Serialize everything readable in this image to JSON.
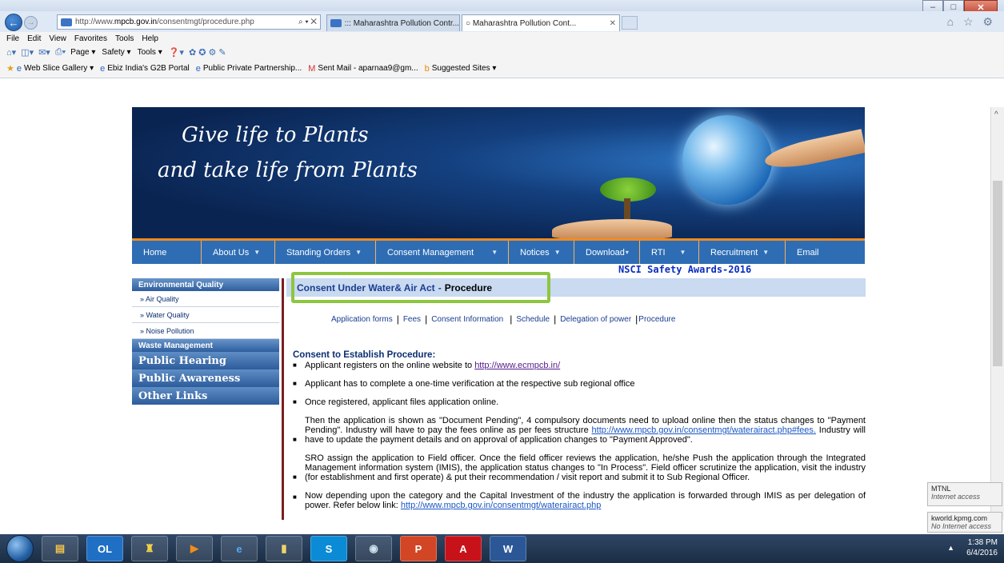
{
  "browser": {
    "url_prefix": "http://www.",
    "url_domain": "mpcb.gov.in",
    "url_path": "/consentmgt/procedure.php",
    "address_tools": "⌕ ▾ ✕",
    "tabs": [
      {
        "label": "::: Maharashtra Pollution Contr..."
      },
      {
        "label": "Maharashtra Pollution Cont...",
        "close": "✕"
      }
    ],
    "right_icons": "⌂ ☆ ⚙"
  },
  "menu": [
    "File",
    "Edit",
    "View",
    "Favorites",
    "Tools",
    "Help"
  ],
  "command_bar": [
    "Page ▾",
    "Safety ▾",
    "Tools ▾"
  ],
  "favorites": [
    {
      "icon": "★",
      "label": ""
    },
    {
      "icon": "e",
      "label": "Web Slice Gallery ▾"
    },
    {
      "icon": "e",
      "label": "Ebiz India's G2B Portal"
    },
    {
      "icon": "e",
      "label": "Public Private Partnership..."
    },
    {
      "icon": "M",
      "label": "Sent Mail - aparnaa9@gm..."
    },
    {
      "icon": "b",
      "label": "Suggested Sites ▾"
    }
  ],
  "banner": {
    "line1": "Give life to Plants",
    "line2": "and take life from Plants"
  },
  "nav": {
    "items": [
      {
        "label": "Home",
        "caret": ""
      },
      {
        "label": "About Us",
        "caret": "▼"
      },
      {
        "label": "Standing Orders",
        "caret": "▼"
      },
      {
        "label": "Consent Management",
        "caret": "▼"
      },
      {
        "label": "Notices",
        "caret": "▼"
      },
      {
        "label": "Download",
        "caret": "▾"
      },
      {
        "label": "RTI",
        "caret": "▼"
      },
      {
        "label": "Recruitment",
        "caret": "▼"
      },
      {
        "label": "Email",
        "caret": ""
      }
    ],
    "announcement": "NSCI Safety Awards-2016"
  },
  "sidebar": {
    "env_head": "Environmental Quality",
    "env_items": [
      "» Air Quality",
      "» Water Quality",
      "» Noise Pollution"
    ],
    "waste_head": "Waste Management",
    "big_items": [
      "Public Hearing",
      "Public Awareness",
      "Other Links"
    ]
  },
  "main": {
    "heading_blue": "Consent Under Water& Air Act",
    "heading_dash": "-",
    "heading_black": "Procedure",
    "links": [
      "Application forms",
      "Fees",
      "Consent Information",
      "Schedule",
      "Delegation of power",
      "Procedure"
    ],
    "section_title": "Consent to Establish Procedure:",
    "bullets": {
      "b1_text": "Applicant registers on the online website to ",
      "b1_link": "http://www.ecmpcb.in/",
      "b2_text": "Applicant has to complete a one-time verification at the respective sub regional office",
      "b3_text": "Once registered, applicant files application online.",
      "b4_text_a": "Then the application is shown as \"Document Pending\", 4 compulsory documents need to upload online then the status changes to \"Payment Pending\". Industry will have to pay the fees online as per fees structure ",
      "b4_link": "http://www.mpcb.gov.in/consentmgt/waterairact.php#fees.",
      "b4_text_b": " Industry will have to update the payment details and on approval of application changes to \"Payment Approved\".",
      "b5_text": "SRO assign the application to Field officer. Once the field officer reviews the application, he/she Push the application through the Integrated Management information system (IMIS), the application status changes to \"In Process\". Field officer scrutinize the application, visit the industry (for establishment and first operate) & put their recommendation / visit report and submit it to Sub Regional Officer.",
      "b6_text": "Now depending upon the category and the Capital Investment of the industry the application is forwarded through IMIS as per delegation of power. Refer below link: ",
      "b6_link": "http://www.mpcb.gov.in/consentmgt/waterairact.php"
    }
  },
  "notifications": [
    {
      "title": "MTNL",
      "sub": "Internet access"
    },
    {
      "title": "kworld.kpmg.com",
      "sub": "No Internet access"
    }
  ],
  "taskbar": {
    "apps": [
      "OL",
      "",
      "",
      "",
      "e",
      "",
      "S",
      "",
      "P",
      "A",
      "W"
    ],
    "time": "1:38 PM",
    "date": "6/4/2016"
  }
}
